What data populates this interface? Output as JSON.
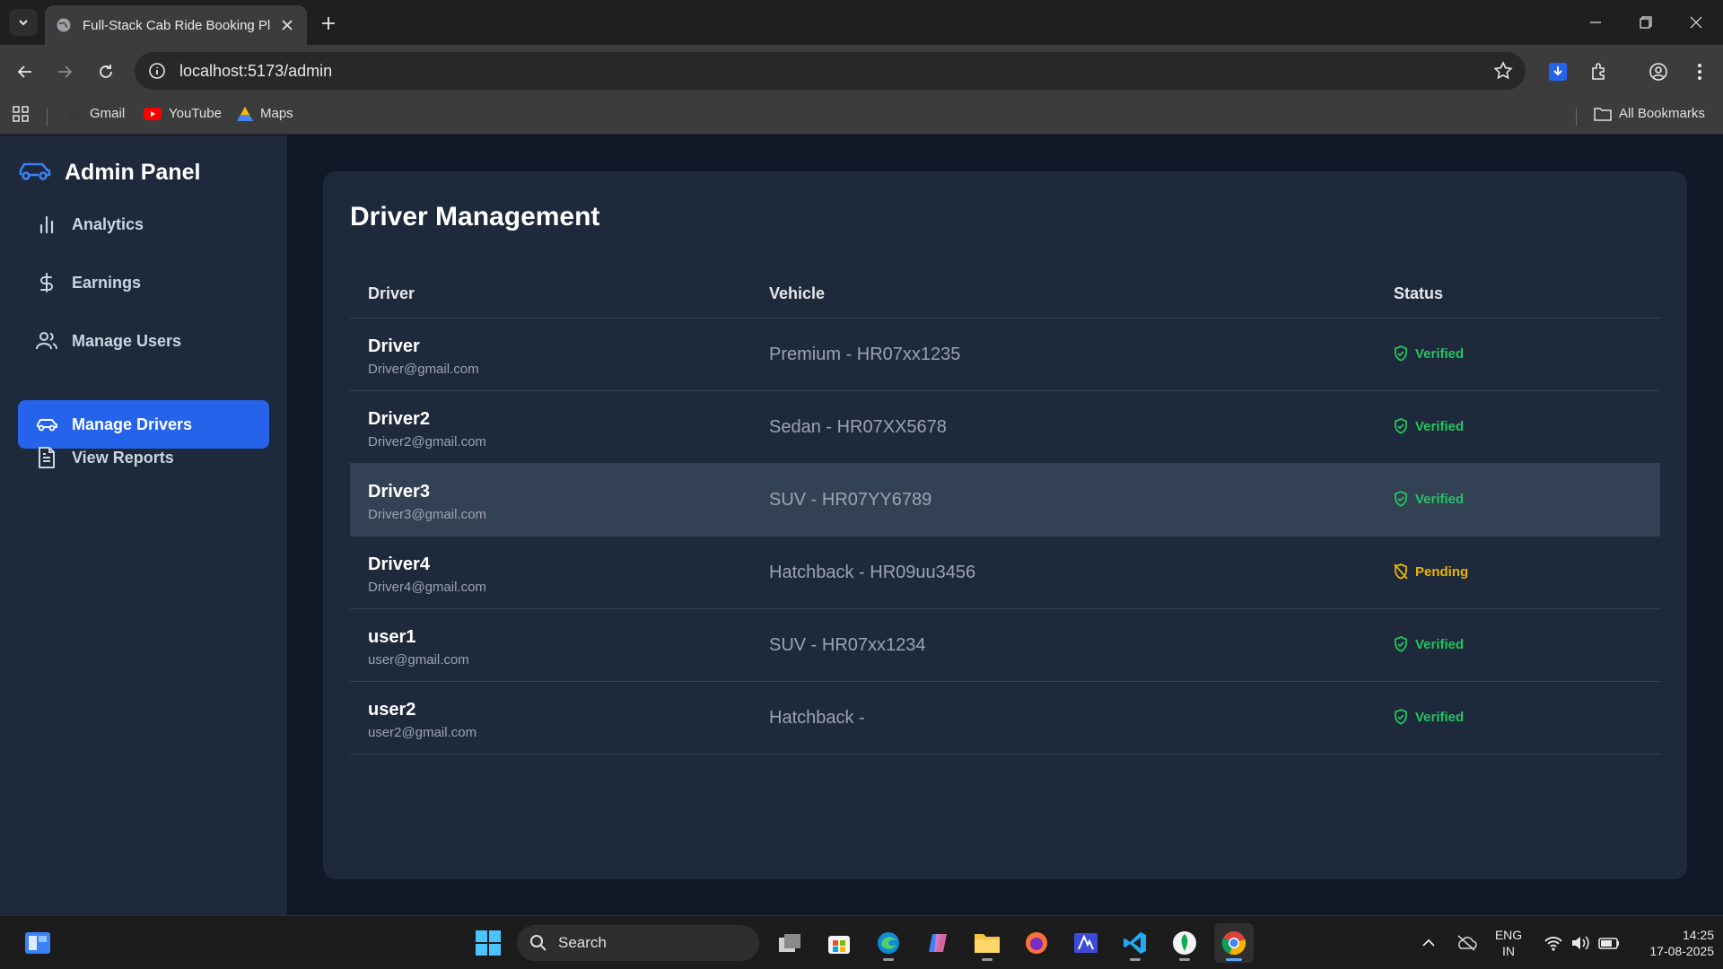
{
  "browser": {
    "tab_title": "Full-Stack Cab Ride Booking Pla",
    "url": "localhost:5173/admin",
    "bookmarks": [
      "Gmail",
      "YouTube",
      "Maps"
    ],
    "all_bookmarks": "All Bookmarks"
  },
  "sidebar": {
    "title": "Admin Panel",
    "items": [
      {
        "label": "Analytics",
        "icon": "bar-chart-icon"
      },
      {
        "label": "Earnings",
        "icon": "dollar-icon"
      },
      {
        "label": "Manage Users",
        "icon": "users-icon"
      },
      {
        "label": "Manage Drivers",
        "icon": "car-icon",
        "active": true
      },
      {
        "label": "View Reports",
        "icon": "document-icon"
      }
    ]
  },
  "main": {
    "title": "Driver Management",
    "columns": [
      "Driver",
      "Vehicle",
      "Status"
    ],
    "rows": [
      {
        "name": "Driver",
        "email": "Driver@gmail.com",
        "vehicle": "Premium - HR07xx1235",
        "status": "Verified"
      },
      {
        "name": "Driver2",
        "email": "Driver2@gmail.com",
        "vehicle": "Sedan - HR07XX5678",
        "status": "Verified"
      },
      {
        "name": "Driver3",
        "email": "Driver3@gmail.com",
        "vehicle": "SUV - HR07YY6789",
        "status": "Verified"
      },
      {
        "name": "Driver4",
        "email": "Driver4@gmail.com",
        "vehicle": "Hatchback - HR09uu3456",
        "status": "Pending"
      },
      {
        "name": "user1",
        "email": "user@gmail.com",
        "vehicle": "SUV - HR07xx1234",
        "status": "Verified"
      },
      {
        "name": "user2",
        "email": "user2@gmail.com",
        "vehicle": "Hatchback -",
        "status": "Verified"
      }
    ]
  },
  "taskbar": {
    "search": "Search",
    "lang_1": "ENG",
    "lang_2": "IN",
    "time": "14:25",
    "date": "17-08-2025"
  },
  "colors": {
    "accent": "#2563eb",
    "verified": "#22c55e",
    "pending": "#eab308"
  }
}
